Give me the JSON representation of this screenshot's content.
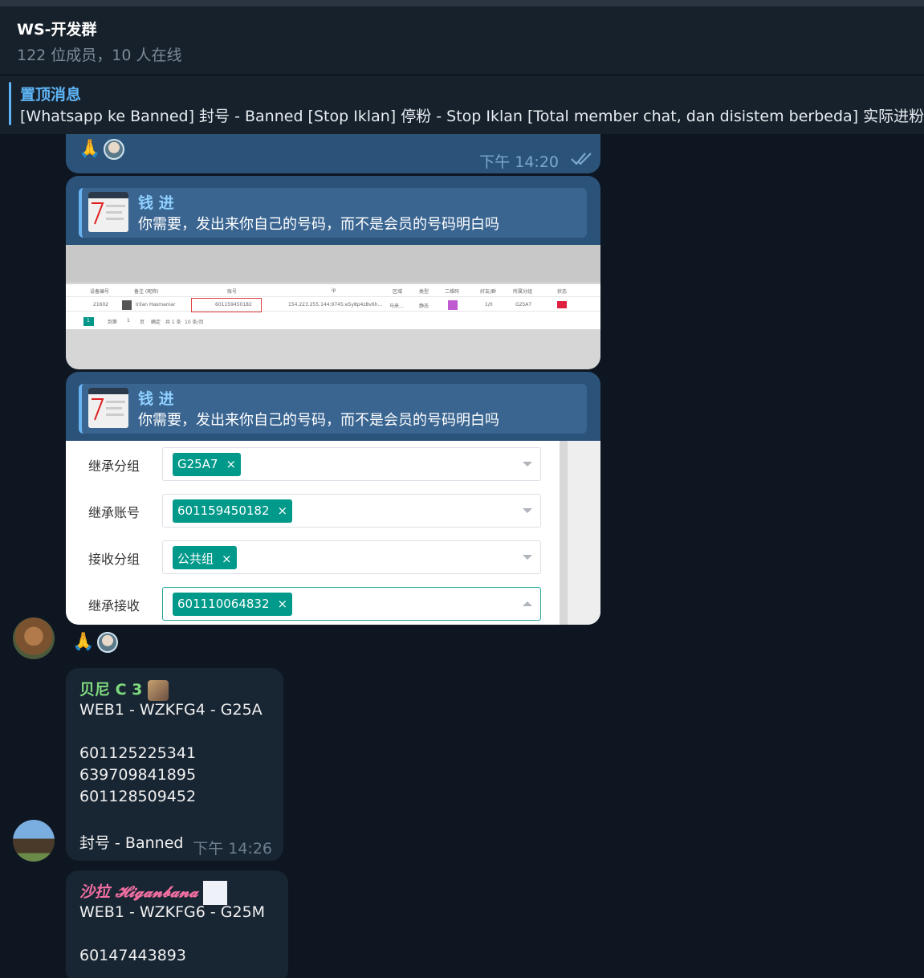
{
  "header": {
    "title": "WS-开发群",
    "subtitle": "122 位成员，10 人在线"
  },
  "pinned": {
    "label": "置顶消息",
    "text": "[Whatsapp ke Banned] 封号 - Banned  [Stop Iklan] 停粉 - Stop Iklan  [Total member chat, dan disistem berbeda] 实际进粉："
  },
  "messages": [
    {
      "reactions": [
        "🙏"
      ],
      "time": "下午 14:20",
      "status_icon": "double-check-icon"
    },
    {
      "reply": {
        "name": "钱 进",
        "text": "你需要，发出来你自己的号码，而不是会员的号码明白吗"
      },
      "screenshot_table": {
        "headers": [
          "设备编号",
          "备注 (昵称)",
          "账号",
          "ip",
          "区域",
          "类型",
          "二维码",
          "好友/群",
          "所属分组",
          "状态"
        ],
        "row": [
          "21602",
          "Irilan Hasmaniar",
          "601159450182",
          "154.223.255.144:9745:e5y8p4z8v6h...",
          "马来...",
          "静态",
          "",
          "1/0",
          "G25A7",
          ""
        ],
        "pager": [
          "1",
          "到第",
          "1",
          "页",
          "确定",
          "共 1 条",
          "10 条/页"
        ]
      }
    },
    {
      "reply": {
        "name": "钱 进",
        "text": "你需要，发出来你自己的号码，而不是会员的号码明白吗"
      },
      "form": [
        {
          "label": "继承分组",
          "tag": "G25A7"
        },
        {
          "label": "继承账号",
          "tag": "601159450182"
        },
        {
          "label": "接收分组",
          "tag": "公共组"
        },
        {
          "label": "继承接收",
          "tag": "601110064832"
        }
      ],
      "reactions": [
        "🙏"
      ]
    },
    {
      "sender": "贝尼 C 3",
      "sender_color": "#7ed97e",
      "lines": [
        "WEB1 - WZKFG4 - G25A",
        "",
        "601125225341",
        "639709841895",
        "601128509452",
        "",
        "封号 - Banned"
      ],
      "time": "下午 14:26"
    },
    {
      "sender": "沙拉 𝓗𝓲𝓰𝓪𝓷𝓫𝓪𝓷𝓪",
      "sender_color": "#f06fa0",
      "lines": [
        "WEB1 - WZKFG6 - G25M",
        "",
        "60147443893"
      ]
    }
  ],
  "tag_remove_symbol": "×"
}
